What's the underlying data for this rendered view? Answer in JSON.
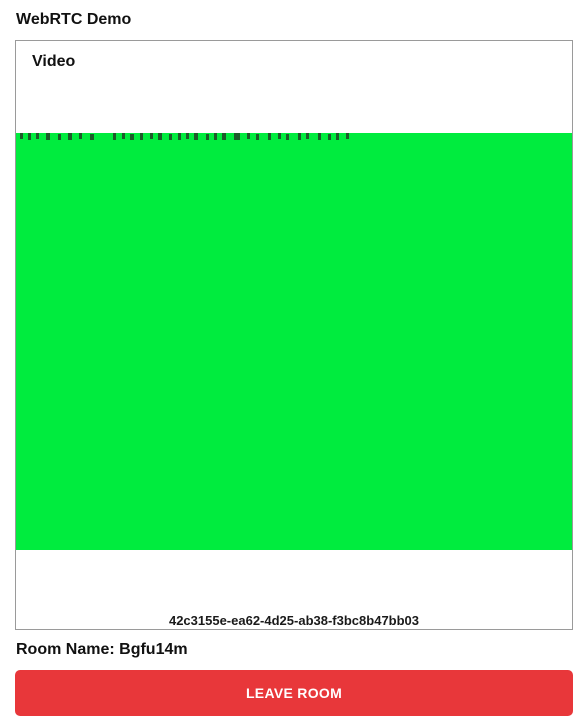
{
  "app": {
    "title": "WebRTC Demo"
  },
  "video_panel": {
    "heading": "Video",
    "participant_id": "42c3155e-ea62-4d25-ab38-f3bc8b47bb03",
    "stream_color": "#00ec3e"
  },
  "room": {
    "label": "Room Name:",
    "name": "Bgfu14m"
  },
  "actions": {
    "leave_label": "LEAVE ROOM",
    "leave_color": "#e8373a"
  }
}
